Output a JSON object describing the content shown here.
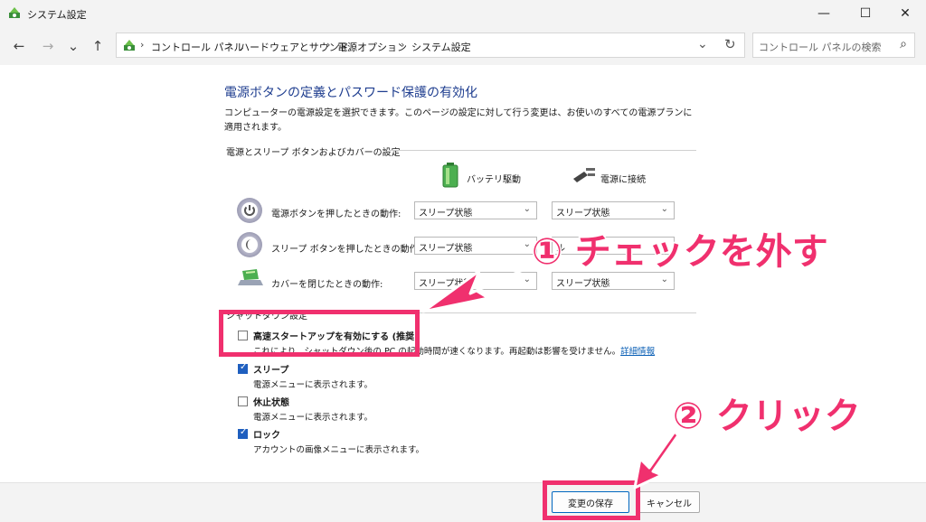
{
  "window": {
    "title": "システム設定"
  },
  "titlebar_controls": {
    "minimize": "—",
    "maximize": "☐",
    "close": "✕"
  },
  "nav": {
    "back": "←",
    "forward": "→",
    "recent": "⌄",
    "up": "↑",
    "refresh": "↻",
    "dropdown": "⌄"
  },
  "breadcrumb": [
    "コントロール パネル",
    "ハードウェアとサウンド",
    "電源オプション",
    "システム設定"
  ],
  "breadcrumb_sep": "›",
  "search": {
    "placeholder": "コントロール パネルの検索"
  },
  "heading": "電源ボタンの定義とパスワード保護の有効化",
  "description": "コンピューターの電源設定を選択できます。このページの設定に対して行う変更は、お使いのすべての電源プランに適用されます。",
  "power_section": {
    "title": "電源とスリープ ボタンおよびカバーの設定",
    "col_battery": "バッテリ駆動",
    "col_plugged": "電源に接続",
    "rows": [
      {
        "label": "電源ボタンを押したときの動作:",
        "battery": "スリープ状態",
        "plugged": "スリープ状態"
      },
      {
        "label": "スリープ ボタンを押したときの動作:",
        "battery": "スリープ状態",
        "plugged": "ル"
      },
      {
        "label": "カバーを閉じたときの動作:",
        "battery": "スリープ状態",
        "plugged": "スリープ状態"
      }
    ]
  },
  "shutdown_section": {
    "title": "シャットダウン設定",
    "items": [
      {
        "label": "高速スタートアップを有効にする (推奨)",
        "desc": "これにより、シャットダウン後の PC の起動時間が速くなります。再起動は影響を受けません。",
        "link": "詳細情報",
        "checked": false
      },
      {
        "label": "スリープ",
        "desc": "電源メニューに表示されます。",
        "checked": true
      },
      {
        "label": "休止状態",
        "desc": "電源メニューに表示されます。",
        "checked": false
      },
      {
        "label": "ロック",
        "desc": "アカウントの画像メニューに表示されます。",
        "checked": true
      }
    ]
  },
  "buttons": {
    "save": "変更の保存",
    "cancel": "キャンセル"
  },
  "annotations": {
    "step1": "① チェックを外す",
    "step2": "② クリック",
    "color": "#f0306e"
  },
  "icons": {
    "search": "⌕"
  }
}
